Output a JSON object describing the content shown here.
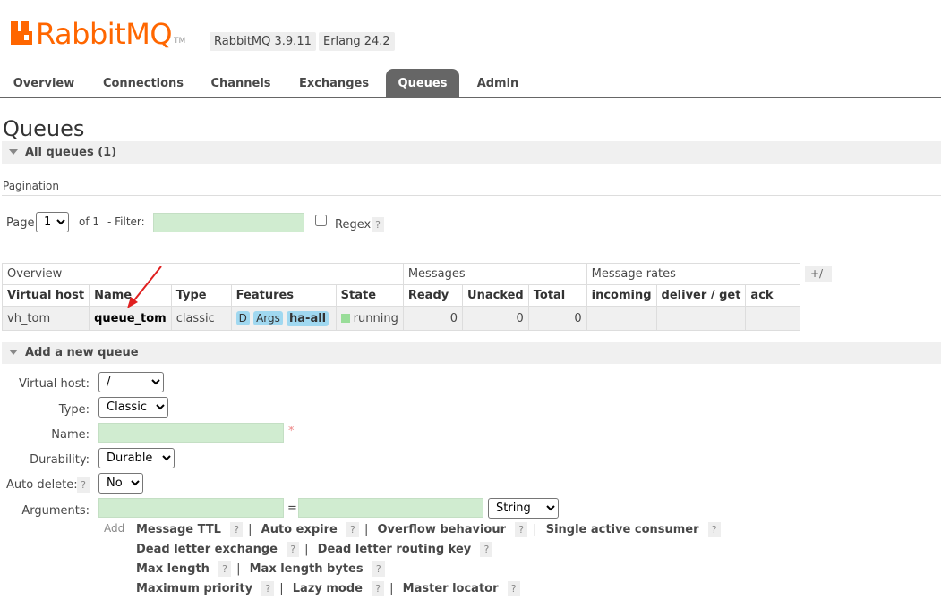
{
  "header": {
    "brand": "RabbitMQ",
    "tm": "TM",
    "version_badge": "RabbitMQ 3.9.11",
    "erlang_badge": "Erlang 24.2"
  },
  "tabs": [
    {
      "label": "Overview"
    },
    {
      "label": "Connections"
    },
    {
      "label": "Channels"
    },
    {
      "label": "Exchanges"
    },
    {
      "label": "Queues",
      "active": true
    },
    {
      "label": "Admin"
    }
  ],
  "page_title": "Queues",
  "all_queues": {
    "label": "All queues (1)"
  },
  "pagination": {
    "heading": "Pagination",
    "page_label": "Page",
    "page_value": "1",
    "of_label": "of 1",
    "filter_label": "- Filter:",
    "filter_value": "",
    "regex_label": "Regex",
    "help": "?"
  },
  "table": {
    "groups": {
      "overview": "Overview",
      "messages": "Messages",
      "rates": "Message rates"
    },
    "plusminus": "+/-",
    "columns": [
      "Virtual host",
      "Name",
      "Type",
      "Features",
      "State",
      "Ready",
      "Unacked",
      "Total",
      "incoming",
      "deliver / get",
      "ack"
    ],
    "rows": [
      {
        "vhost": "vh_tom",
        "name": "queue_tom",
        "type": "classic",
        "features": [
          "D",
          "Args",
          "ha-all"
        ],
        "state": "running",
        "ready": "0",
        "unacked": "0",
        "total": "0",
        "incoming": "",
        "deliver_get": "",
        "ack": ""
      }
    ]
  },
  "add_queue": {
    "title": "Add a new queue",
    "vhost_label": "Virtual host:",
    "vhost_value": "/",
    "type_label": "Type:",
    "type_value": "Classic",
    "name_label": "Name:",
    "name_value": "",
    "required_mark": "*",
    "durability_label": "Durability:",
    "durability_value": "Durable",
    "autodelete_label": "Auto delete:",
    "autodelete_help": "?",
    "autodelete_value": "No",
    "arguments_label": "Arguments:",
    "arg_key": "",
    "arg_eq": "=",
    "arg_value": "",
    "arg_type": "String",
    "add_label": "Add",
    "arg_links_row1": [
      "Message TTL",
      "Auto expire",
      "Overflow behaviour",
      "Single active consumer"
    ],
    "arg_links_row2": [
      "Dead letter exchange",
      "Dead letter routing key"
    ],
    "arg_links_row3": [
      "Max length",
      "Max length bytes"
    ],
    "arg_links_row4": [
      "Maximum priority",
      "Lazy mode",
      "Master locator"
    ],
    "help": "?",
    "separator": "|"
  },
  "colors": {
    "brand": "#ff6600",
    "tab_active": "#666666",
    "input_green": "#d0ecd0",
    "feature_badge": "#a0d8f0",
    "state_running": "#99dd99",
    "annotation_arrow": "#e02020"
  }
}
